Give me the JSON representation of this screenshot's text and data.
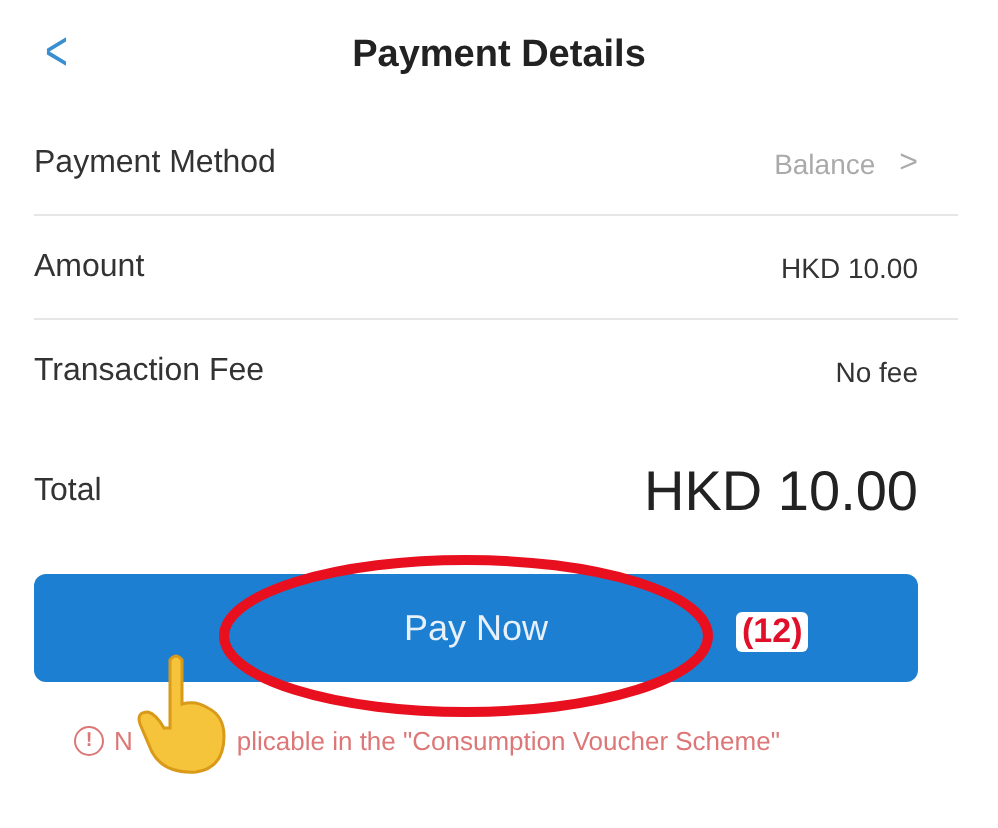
{
  "header": {
    "back": "<",
    "title": "Payment Details"
  },
  "rows": [
    {
      "kind": "link",
      "label": "Payment Method",
      "value": "Balance",
      "chevron": ">"
    },
    {
      "kind": "plain",
      "label": "Amount",
      "value": "HKD 10.00"
    },
    {
      "kind": "plain",
      "label": "Transaction Fee",
      "value": "No fee"
    }
  ],
  "total": {
    "label": "Total",
    "value": "HKD 10.00"
  },
  "pay_button": "Pay Now",
  "annotation": {
    "step": "(12)"
  },
  "notice": {
    "icon": "!",
    "visible_parts": [
      "N",
      "plicable in the \"Consumption Voucher Scheme\""
    ]
  }
}
